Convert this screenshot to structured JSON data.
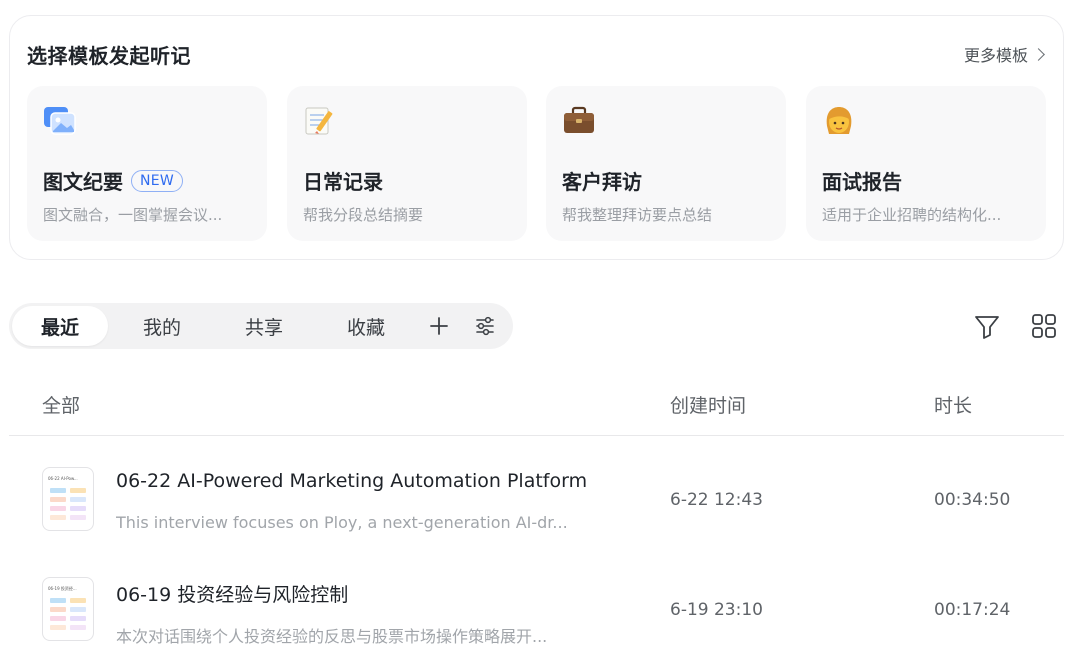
{
  "templates": {
    "title": "选择模板发起听记",
    "more_label": "更多模板",
    "cards": [
      {
        "icon": "image-gallery-icon",
        "title": "图文纪要",
        "badge": "NEW",
        "desc": "图文融合，一图掌握会议..."
      },
      {
        "icon": "memo-pencil-icon",
        "title": "日常记录",
        "badge": "",
        "desc": "帮我分段总结摘要"
      },
      {
        "icon": "briefcase-icon",
        "title": "客户拜访",
        "badge": "",
        "desc": "帮我整理拜访要点总结"
      },
      {
        "icon": "woman-face-icon",
        "title": "面试报告",
        "badge": "",
        "desc": "适用于企业招聘的结构化..."
      }
    ]
  },
  "tabs": {
    "items": [
      "最近",
      "我的",
      "共享",
      "收藏"
    ],
    "active_index": 0
  },
  "toolbar": {
    "filter_icon": "filter-icon",
    "grid_icon": "grid-view-icon"
  },
  "list": {
    "headers": {
      "name": "全部",
      "created": "创建时间",
      "duration": "时长"
    },
    "rows": [
      {
        "title": "06-22 AI-Powered Marketing Automation Platform",
        "desc": "This interview focuses on Ploy, a next-generation AI-dr...",
        "thumb_label": "06-22 AI-Pow...",
        "created": "6-22 12:43",
        "duration": "00:34:50"
      },
      {
        "title": "06-19 投资经验与风险控制",
        "desc": "本次对话围绕个人投资经验的反思与股票市场操作策略展开...",
        "thumb_label": "06-19 投资经...",
        "created": "6-19 23:10",
        "duration": "00:17:24"
      }
    ]
  },
  "colors": {
    "accent_blue": "#2f6bf0",
    "text_primary": "#1f2329",
    "text_secondary": "#5f6368",
    "text_muted": "#a1a5aa"
  }
}
